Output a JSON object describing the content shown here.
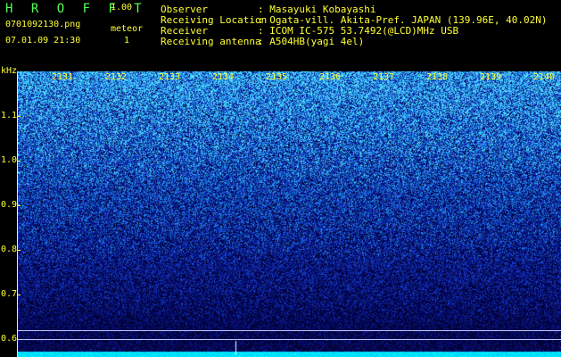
{
  "app": {
    "name": "H R O F F T",
    "version": "1.00"
  },
  "file": {
    "name": "0701092130.png",
    "datetime": "07.01.09 21:30"
  },
  "meteor": {
    "label": "meteor",
    "count": "1"
  },
  "meta": {
    "observer_label": "Observer",
    "observer_value": ": Masayuki Kobayashi",
    "location_label": "Receiving Location",
    "location_value": ": Ogata-vill. Akita-Pref. JAPAN (139.96E, 40.02N)",
    "receiver_label": "Receiver",
    "receiver_value": ": ICOM IC-575 53.7492(@LCD)MHz USB",
    "antenna_label": "Receiving antenna",
    "antenna_value": ": A504HB(yagi 4el)"
  },
  "axis": {
    "unit": "kHz",
    "y_ticks": [
      "1.1",
      "1.0",
      "0.9",
      "0.8",
      "0.7",
      "0.6"
    ],
    "x_ticks": [
      "2131",
      "2132",
      "2133",
      "2134",
      "2135",
      "2136",
      "2137",
      "2138",
      "2139",
      "2140"
    ]
  },
  "colors": {
    "header_text": "#ffff33",
    "background": "#000000",
    "spectrum_low": "#000066",
    "spectrum_high": "#33ccff",
    "marker_line": "#bfc8ff",
    "baseline": "#00ffff"
  }
}
